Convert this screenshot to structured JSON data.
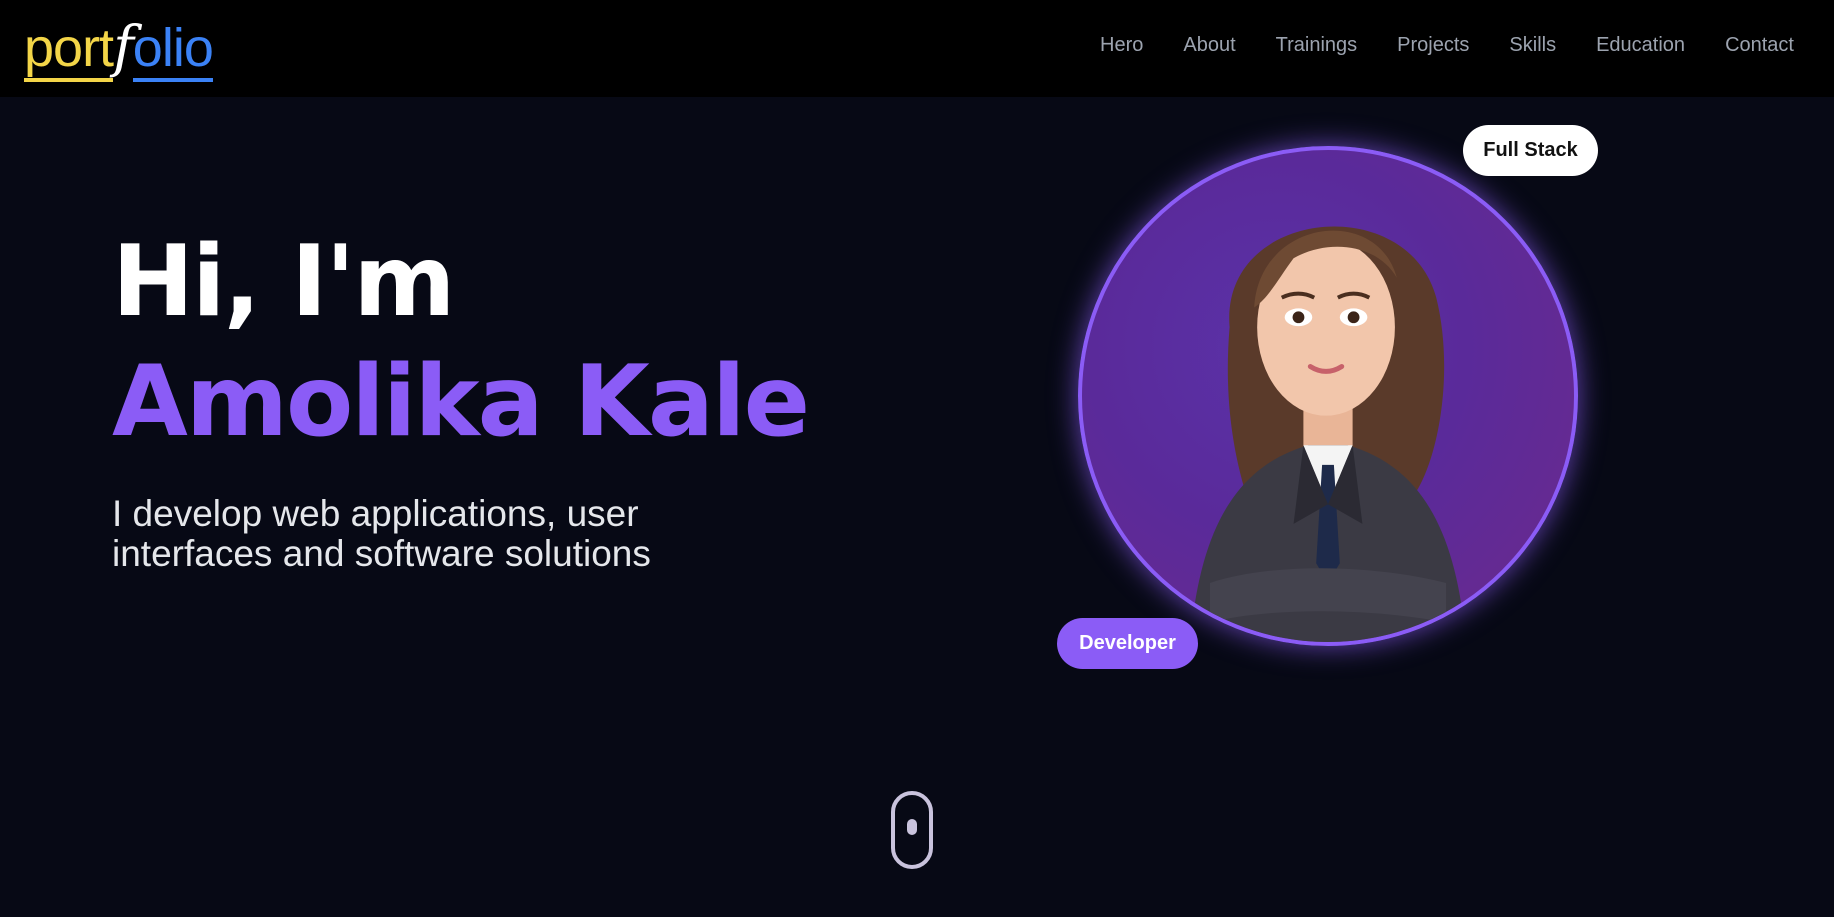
{
  "nav": {
    "logo": {
      "part1": "port",
      "part2": "f",
      "part3": "olio"
    },
    "links": [
      "Hero",
      "About",
      "Trainings",
      "Projects",
      "Skills",
      "Education",
      "Contact"
    ]
  },
  "hero": {
    "greeting": "Hi, I'm",
    "first_name": "Amolika",
    "last_name": "Kale",
    "subtitle": "I develop web applications, user interfaces and software solutions",
    "badge_top": "Full Stack",
    "badge_bottom": "Developer"
  },
  "colors": {
    "background": "#070915",
    "navbar": "#000000",
    "accent": "#8b5cf6",
    "logo_yellow": "#f3d548",
    "logo_blue": "#3b82f6",
    "nav_text": "#9ca3af"
  },
  "icons": {
    "scroll_indicator": "mouse-scroll-icon",
    "avatar": "avatar-illustration"
  }
}
